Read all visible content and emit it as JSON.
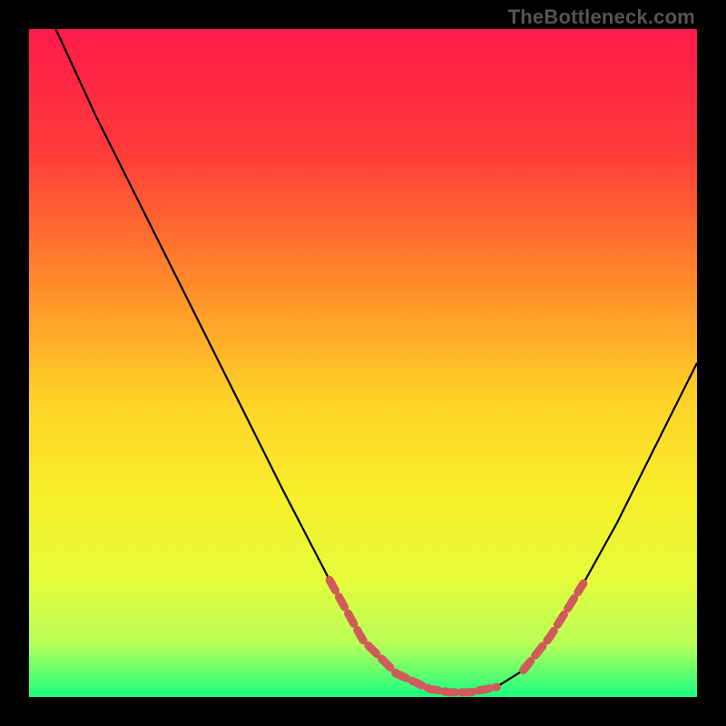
{
  "watermark": "TheBottleneck.com",
  "chart_data": {
    "type": "line",
    "title": "",
    "xlabel": "",
    "ylabel": "",
    "xlim": [
      0,
      100
    ],
    "ylim": [
      0,
      100
    ],
    "gradient_stops": [
      {
        "offset": 0,
        "color": "#ff1a4b"
      },
      {
        "offset": 18,
        "color": "#ff3a3a"
      },
      {
        "offset": 38,
        "color": "#ff8a2a"
      },
      {
        "offset": 55,
        "color": "#ffd128"
      },
      {
        "offset": 70,
        "color": "#f7ef2a"
      },
      {
        "offset": 82,
        "color": "#e6fb3a"
      },
      {
        "offset": 92,
        "color": "#b9ff58"
      },
      {
        "offset": 100,
        "color": "#1aff82"
      }
    ],
    "series": [
      {
        "name": "curve",
        "type": "line",
        "color": "#000000",
        "x": [
          4,
          10,
          17,
          24,
          31,
          38,
          45,
          50,
          55,
          60,
          63,
          66,
          70,
          74,
          78,
          83,
          88,
          93,
          98,
          100
        ],
        "y": [
          100,
          87,
          73,
          59,
          45,
          31,
          17.5,
          8.5,
          3.5,
          1.2,
          0.7,
          0.7,
          1.5,
          4,
          9,
          17,
          26,
          36,
          46,
          50
        ]
      },
      {
        "name": "dashed-left",
        "type": "dashed",
        "color": "#cf5b5b",
        "stroke_width": 9,
        "dash": "13 8",
        "x": [
          45,
          50,
          55
        ],
        "y": [
          17.5,
          8.5,
          3.5
        ]
      },
      {
        "name": "dashed-bottom",
        "type": "dashed",
        "color": "#cf5b5b",
        "stroke_width": 9,
        "dash": "12 7",
        "x": [
          55,
          60,
          63,
          66,
          70
        ],
        "y": [
          3.5,
          1.2,
          0.7,
          0.7,
          1.5
        ]
      },
      {
        "name": "dashed-right",
        "type": "dashed",
        "color": "#cf5b5b",
        "stroke_width": 9,
        "dash": "13 8",
        "x": [
          74,
          78,
          83
        ],
        "y": [
          4,
          9,
          17
        ]
      }
    ]
  }
}
